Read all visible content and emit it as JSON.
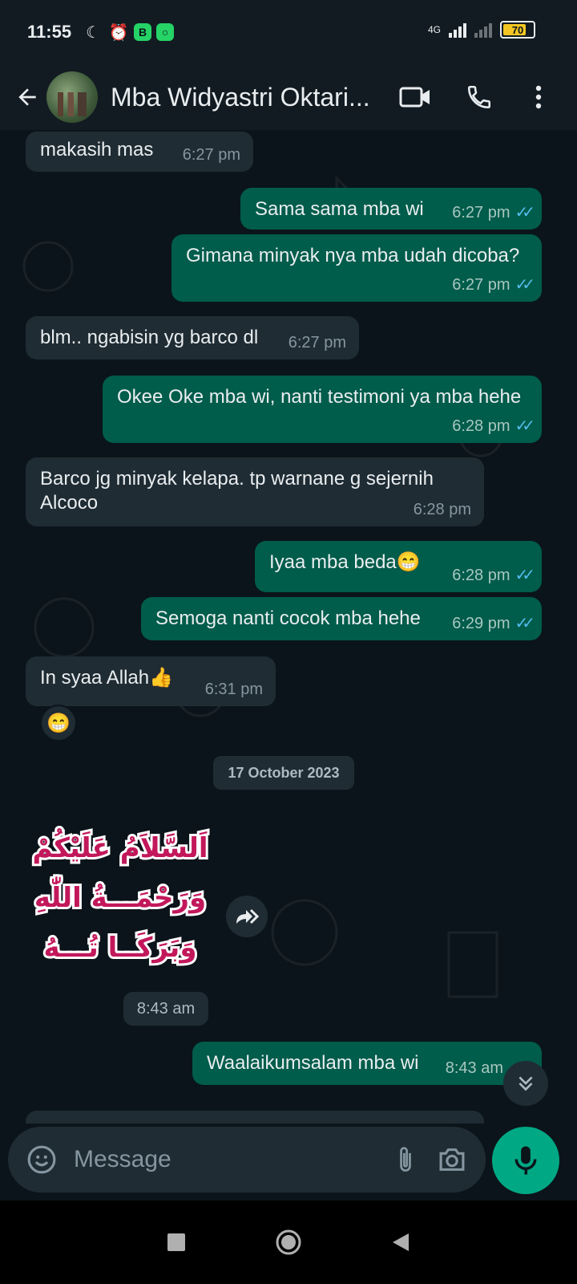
{
  "status_bar": {
    "time": "11:55",
    "network": "4G",
    "battery": "70",
    "icons": [
      "moon-icon",
      "alarm-icon",
      "bbm-icon",
      "app-status-icon",
      "signal-icon",
      "signal-x-icon"
    ]
  },
  "header": {
    "title": "Mba Widyastri Oktari...",
    "icons": [
      "back-arrow-icon",
      "video-call-icon",
      "voice-call-icon",
      "more-vert-icon"
    ]
  },
  "messages": [
    {
      "dir": "in",
      "text": "makasih mas",
      "time": "6:27 pm"
    },
    {
      "dir": "out",
      "text": "Sama sama mba wi",
      "time": "6:27 pm"
    },
    {
      "dir": "out",
      "text": "Gimana minyak nya mba udah dicoba?",
      "time": "6:27 pm"
    },
    {
      "dir": "in",
      "text": "blm.. ngabisin yg barco dl",
      "time": "6:27 pm"
    },
    {
      "dir": "out",
      "text": "Okee Oke mba wi, nanti testimoni ya mba hehe",
      "time": "6:28 pm"
    },
    {
      "dir": "in",
      "text": "Barco jg minyak kelapa. tp warnane g sejernih Alcoco",
      "time": "6:28 pm"
    },
    {
      "dir": "out",
      "text": "Iyaa mba beda😁",
      "time": "6:28 pm"
    },
    {
      "dir": "out",
      "text": "Semoga nanti cocok mba hehe",
      "time": "6:29 pm"
    },
    {
      "dir": "in",
      "text": "In syaa Allah👍",
      "time": "6:31 pm"
    },
    {
      "dir": "out",
      "text": "Waalaikumsalam mba wi",
      "time": "8:43 am"
    }
  ],
  "reaction": "😁",
  "date_divider": "17 October 2023",
  "sticker": {
    "lines": [
      "اَلسَّلاَمُ عَلَيْكُمْ",
      "وَرَحْمَـــةُ اللّٰهِ",
      "وَبَرَكَــا تُـــهُ"
    ],
    "time": "8:43 am"
  },
  "input": {
    "placeholder": "Message"
  },
  "colors": {
    "background": "#0b141a",
    "incoming_bubble": "#1f2c34",
    "outgoing_bubble": "#005c4b",
    "accent": "#00a884",
    "read_ticks": "#53bdeb",
    "sticker_pink": "#c2185b"
  }
}
